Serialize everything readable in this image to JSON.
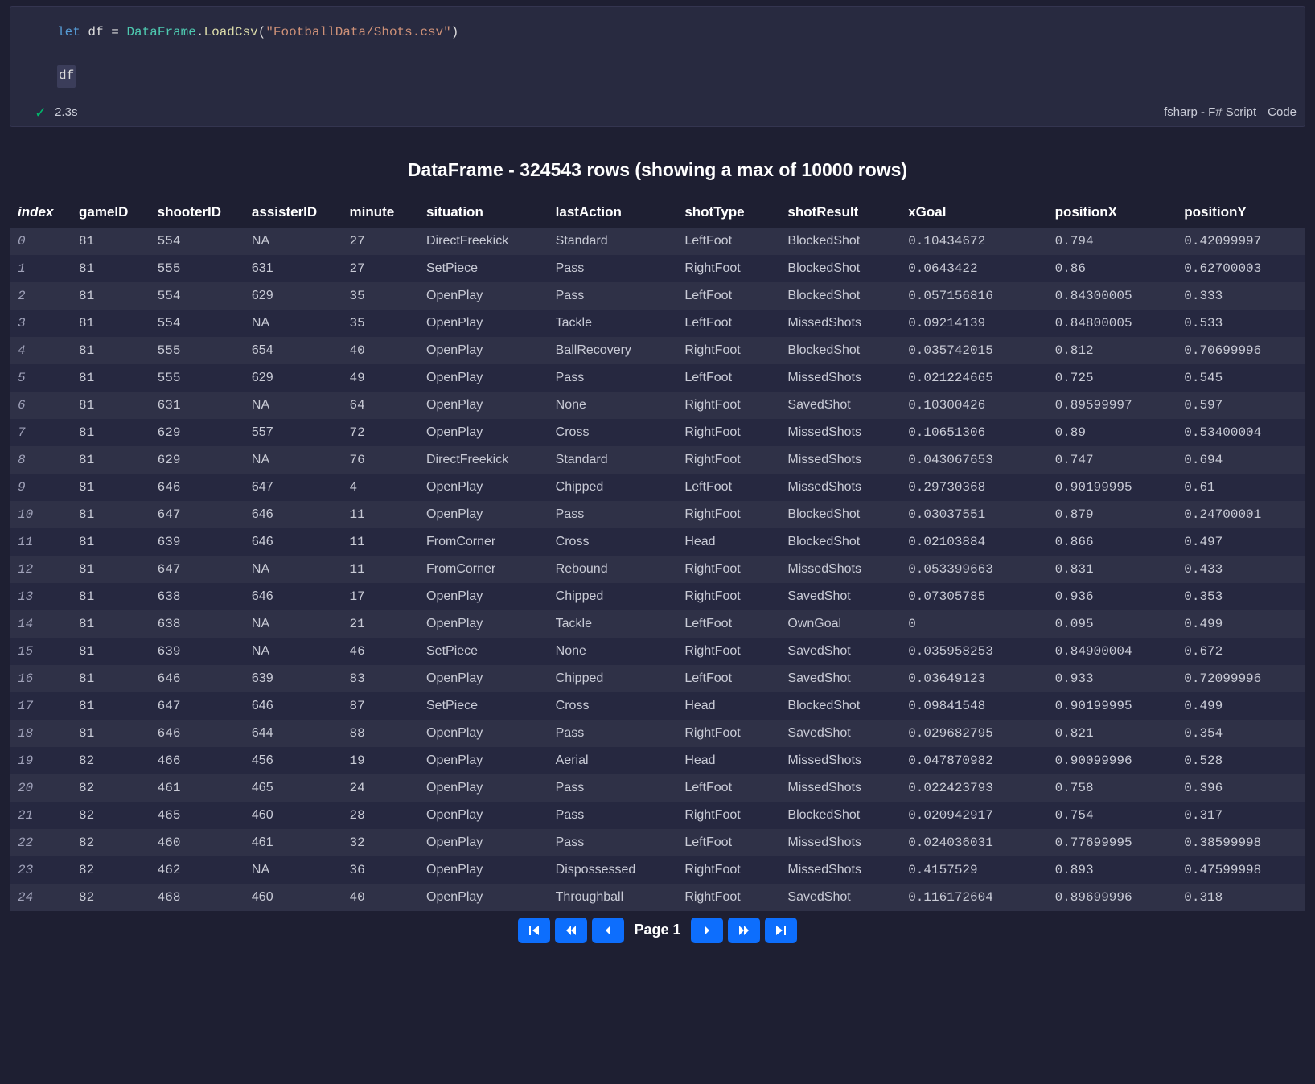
{
  "code": {
    "line1_kw": "let",
    "line1_var": "df",
    "line1_eq": "=",
    "line1_type": "DataFrame",
    "line1_method": "LoadCsv",
    "line1_arg": "\"FootballData/Shots.csv\"",
    "line2_expr": "df"
  },
  "status": {
    "time": "2.3s",
    "lang": "fsharp - F# Script",
    "kind": "Code"
  },
  "output_title": "DataFrame - 324543 rows (showing a max of 10000 rows)",
  "columns": [
    "index",
    "gameID",
    "shooterID",
    "assisterID",
    "minute",
    "situation",
    "lastAction",
    "shotType",
    "shotResult",
    "xGoal",
    "positionX",
    "positionY"
  ],
  "rows": [
    {
      "index": "0",
      "gameID": "81",
      "shooterID": "554",
      "assisterID": "NA",
      "minute": "27",
      "situation": "DirectFreekick",
      "lastAction": "Standard",
      "shotType": "LeftFoot",
      "shotResult": "BlockedShot",
      "xGoal": "0.10434672",
      "positionX": "0.794",
      "positionY": "0.42099997"
    },
    {
      "index": "1",
      "gameID": "81",
      "shooterID": "555",
      "assisterID": "631",
      "minute": "27",
      "situation": "SetPiece",
      "lastAction": "Pass",
      "shotType": "RightFoot",
      "shotResult": "BlockedShot",
      "xGoal": "0.0643422",
      "positionX": "0.86",
      "positionY": "0.62700003"
    },
    {
      "index": "2",
      "gameID": "81",
      "shooterID": "554",
      "assisterID": "629",
      "minute": "35",
      "situation": "OpenPlay",
      "lastAction": "Pass",
      "shotType": "LeftFoot",
      "shotResult": "BlockedShot",
      "xGoal": "0.057156816",
      "positionX": "0.84300005",
      "positionY": "0.333"
    },
    {
      "index": "3",
      "gameID": "81",
      "shooterID": "554",
      "assisterID": "NA",
      "minute": "35",
      "situation": "OpenPlay",
      "lastAction": "Tackle",
      "shotType": "LeftFoot",
      "shotResult": "MissedShots",
      "xGoal": "0.09214139",
      "positionX": "0.84800005",
      "positionY": "0.533"
    },
    {
      "index": "4",
      "gameID": "81",
      "shooterID": "555",
      "assisterID": "654",
      "minute": "40",
      "situation": "OpenPlay",
      "lastAction": "BallRecovery",
      "shotType": "RightFoot",
      "shotResult": "BlockedShot",
      "xGoal": "0.035742015",
      "positionX": "0.812",
      "positionY": "0.70699996"
    },
    {
      "index": "5",
      "gameID": "81",
      "shooterID": "555",
      "assisterID": "629",
      "minute": "49",
      "situation": "OpenPlay",
      "lastAction": "Pass",
      "shotType": "LeftFoot",
      "shotResult": "MissedShots",
      "xGoal": "0.021224665",
      "positionX": "0.725",
      "positionY": "0.545"
    },
    {
      "index": "6",
      "gameID": "81",
      "shooterID": "631",
      "assisterID": "NA",
      "minute": "64",
      "situation": "OpenPlay",
      "lastAction": "None",
      "shotType": "RightFoot",
      "shotResult": "SavedShot",
      "xGoal": "0.10300426",
      "positionX": "0.89599997",
      "positionY": "0.597"
    },
    {
      "index": "7",
      "gameID": "81",
      "shooterID": "629",
      "assisterID": "557",
      "minute": "72",
      "situation": "OpenPlay",
      "lastAction": "Cross",
      "shotType": "RightFoot",
      "shotResult": "MissedShots",
      "xGoal": "0.10651306",
      "positionX": "0.89",
      "positionY": "0.53400004"
    },
    {
      "index": "8",
      "gameID": "81",
      "shooterID": "629",
      "assisterID": "NA",
      "minute": "76",
      "situation": "DirectFreekick",
      "lastAction": "Standard",
      "shotType": "RightFoot",
      "shotResult": "MissedShots",
      "xGoal": "0.043067653",
      "positionX": "0.747",
      "positionY": "0.694"
    },
    {
      "index": "9",
      "gameID": "81",
      "shooterID": "646",
      "assisterID": "647",
      "minute": "4",
      "situation": "OpenPlay",
      "lastAction": "Chipped",
      "shotType": "LeftFoot",
      "shotResult": "MissedShots",
      "xGoal": "0.29730368",
      "positionX": "0.90199995",
      "positionY": "0.61"
    },
    {
      "index": "10",
      "gameID": "81",
      "shooterID": "647",
      "assisterID": "646",
      "minute": "11",
      "situation": "OpenPlay",
      "lastAction": "Pass",
      "shotType": "RightFoot",
      "shotResult": "BlockedShot",
      "xGoal": "0.03037551",
      "positionX": "0.879",
      "positionY": "0.24700001"
    },
    {
      "index": "11",
      "gameID": "81",
      "shooterID": "639",
      "assisterID": "646",
      "minute": "11",
      "situation": "FromCorner",
      "lastAction": "Cross",
      "shotType": "Head",
      "shotResult": "BlockedShot",
      "xGoal": "0.02103884",
      "positionX": "0.866",
      "positionY": "0.497"
    },
    {
      "index": "12",
      "gameID": "81",
      "shooterID": "647",
      "assisterID": "NA",
      "minute": "11",
      "situation": "FromCorner",
      "lastAction": "Rebound",
      "shotType": "RightFoot",
      "shotResult": "MissedShots",
      "xGoal": "0.053399663",
      "positionX": "0.831",
      "positionY": "0.433"
    },
    {
      "index": "13",
      "gameID": "81",
      "shooterID": "638",
      "assisterID": "646",
      "minute": "17",
      "situation": "OpenPlay",
      "lastAction": "Chipped",
      "shotType": "RightFoot",
      "shotResult": "SavedShot",
      "xGoal": "0.07305785",
      "positionX": "0.936",
      "positionY": "0.353"
    },
    {
      "index": "14",
      "gameID": "81",
      "shooterID": "638",
      "assisterID": "NA",
      "minute": "21",
      "situation": "OpenPlay",
      "lastAction": "Tackle",
      "shotType": "LeftFoot",
      "shotResult": "OwnGoal",
      "xGoal": "0",
      "positionX": "0.095",
      "positionY": "0.499"
    },
    {
      "index": "15",
      "gameID": "81",
      "shooterID": "639",
      "assisterID": "NA",
      "minute": "46",
      "situation": "SetPiece",
      "lastAction": "None",
      "shotType": "RightFoot",
      "shotResult": "SavedShot",
      "xGoal": "0.035958253",
      "positionX": "0.84900004",
      "positionY": "0.672"
    },
    {
      "index": "16",
      "gameID": "81",
      "shooterID": "646",
      "assisterID": "639",
      "minute": "83",
      "situation": "OpenPlay",
      "lastAction": "Chipped",
      "shotType": "LeftFoot",
      "shotResult": "SavedShot",
      "xGoal": "0.03649123",
      "positionX": "0.933",
      "positionY": "0.72099996"
    },
    {
      "index": "17",
      "gameID": "81",
      "shooterID": "647",
      "assisterID": "646",
      "minute": "87",
      "situation": "SetPiece",
      "lastAction": "Cross",
      "shotType": "Head",
      "shotResult": "BlockedShot",
      "xGoal": "0.09841548",
      "positionX": "0.90199995",
      "positionY": "0.499"
    },
    {
      "index": "18",
      "gameID": "81",
      "shooterID": "646",
      "assisterID": "644",
      "minute": "88",
      "situation": "OpenPlay",
      "lastAction": "Pass",
      "shotType": "RightFoot",
      "shotResult": "SavedShot",
      "xGoal": "0.029682795",
      "positionX": "0.821",
      "positionY": "0.354"
    },
    {
      "index": "19",
      "gameID": "82",
      "shooterID": "466",
      "assisterID": "456",
      "minute": "19",
      "situation": "OpenPlay",
      "lastAction": "Aerial",
      "shotType": "Head",
      "shotResult": "MissedShots",
      "xGoal": "0.047870982",
      "positionX": "0.90099996",
      "positionY": "0.528"
    },
    {
      "index": "20",
      "gameID": "82",
      "shooterID": "461",
      "assisterID": "465",
      "minute": "24",
      "situation": "OpenPlay",
      "lastAction": "Pass",
      "shotType": "LeftFoot",
      "shotResult": "MissedShots",
      "xGoal": "0.022423793",
      "positionX": "0.758",
      "positionY": "0.396"
    },
    {
      "index": "21",
      "gameID": "82",
      "shooterID": "465",
      "assisterID": "460",
      "minute": "28",
      "situation": "OpenPlay",
      "lastAction": "Pass",
      "shotType": "RightFoot",
      "shotResult": "BlockedShot",
      "xGoal": "0.020942917",
      "positionX": "0.754",
      "positionY": "0.317"
    },
    {
      "index": "22",
      "gameID": "82",
      "shooterID": "460",
      "assisterID": "461",
      "minute": "32",
      "situation": "OpenPlay",
      "lastAction": "Pass",
      "shotType": "LeftFoot",
      "shotResult": "MissedShots",
      "xGoal": "0.024036031",
      "positionX": "0.77699995",
      "positionY": "0.38599998"
    },
    {
      "index": "23",
      "gameID": "82",
      "shooterID": "462",
      "assisterID": "NA",
      "minute": "36",
      "situation": "OpenPlay",
      "lastAction": "Dispossessed",
      "shotType": "RightFoot",
      "shotResult": "MissedShots",
      "xGoal": "0.4157529",
      "positionX": "0.893",
      "positionY": "0.47599998"
    },
    {
      "index": "24",
      "gameID": "82",
      "shooterID": "468",
      "assisterID": "460",
      "minute": "40",
      "situation": "OpenPlay",
      "lastAction": "Throughball",
      "shotType": "RightFoot",
      "shotResult": "SavedShot",
      "xGoal": "0.116172604",
      "positionX": "0.89699996",
      "positionY": "0.318"
    }
  ],
  "pager": {
    "label": "Page 1"
  }
}
